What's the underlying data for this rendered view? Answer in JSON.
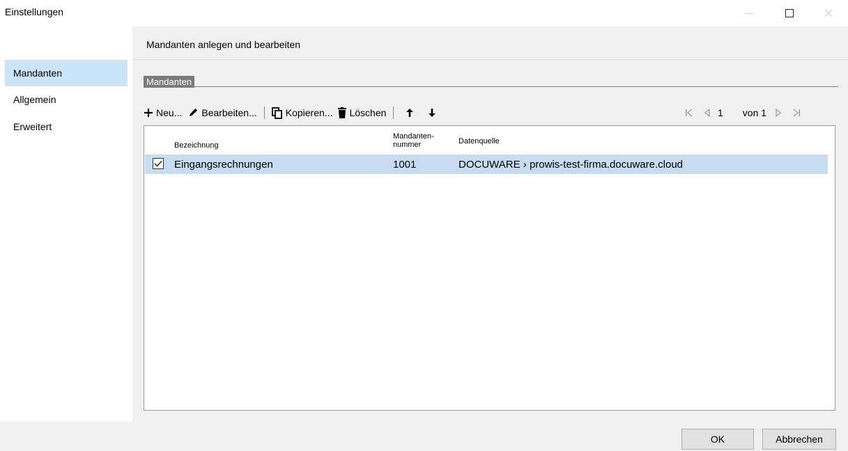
{
  "window": {
    "title": "Einstellungen"
  },
  "nav": {
    "items": [
      {
        "label": "Mandanten",
        "active": true
      },
      {
        "label": "Allgemein",
        "active": false
      },
      {
        "label": "Erweitert",
        "active": false
      }
    ]
  },
  "main": {
    "heading": "Mandanten anlegen und bearbeiten",
    "group_label": "Mandanten"
  },
  "toolbar": {
    "new_label": "Neu...",
    "edit_label": "Bearbeiten...",
    "copy_label": "Kopieren...",
    "delete_label": "Löschen"
  },
  "pager": {
    "page": "1",
    "of_label": "von 1"
  },
  "grid": {
    "columns": {
      "name": "Bezeichnung",
      "number_line1": "Mandanten-",
      "number_line2": "nummer",
      "source": "Datenquelle"
    },
    "rows": [
      {
        "checked": true,
        "name": "Eingangsrechnungen",
        "number": "1001",
        "source": "DOCUWARE › prowis-test-firma.docuware.cloud"
      }
    ]
  },
  "footer": {
    "ok_label": "OK",
    "cancel_label": "Abbrechen"
  },
  "colors": {
    "selection": "#c7dcf0",
    "nav_active": "#cce4f7",
    "panel": "#f0f0f0",
    "group_label_bg": "#7b7b7b"
  }
}
